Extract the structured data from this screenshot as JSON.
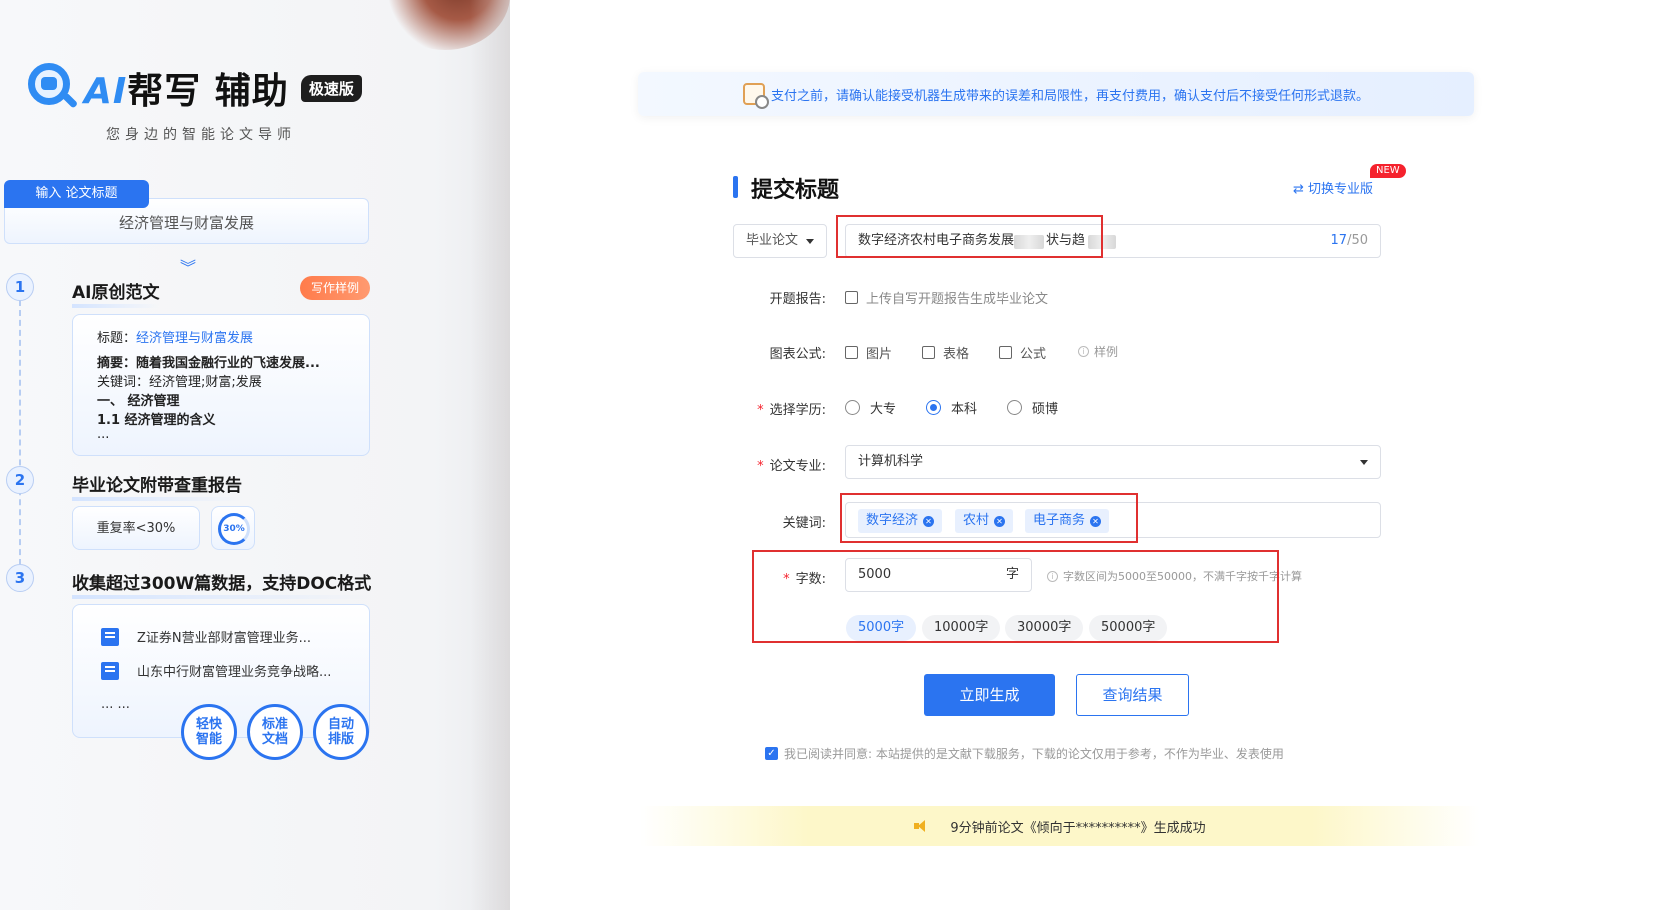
{
  "brand": {
    "logo_ai": "AI",
    "logo_name": "帮写 辅助",
    "logo_badge": "极速版",
    "slogan": "您身边的智能论文导师"
  },
  "sidebar": {
    "input_tab": "输入 论文标题",
    "input_value": "经济管理与财富发展",
    "steps": [
      {
        "num": "1",
        "title": "AI原创范文",
        "badge": "写作样例"
      },
      {
        "num": "2",
        "title": "毕业论文附带查重报告"
      },
      {
        "num": "3",
        "title": "收集超过300W篇数据，支持DOC格式"
      }
    ],
    "sample": {
      "title_label": "标题：",
      "title_value": "经济管理与财富发展",
      "abstract": "摘要：随着我国金融行业的飞速发展...",
      "keywords": "关键词：经济管理;财富;发展",
      "heading1": "一、 经济管理",
      "heading11": "1.1 经济管理的含义",
      "ellipsis": "..."
    },
    "report": {
      "rate": "重复率<30%",
      "ring": "30%",
      "ring_value": 30
    },
    "docs": [
      "Z证券N营业部财富管理业务...",
      "山东中行财富管理业务竞争战略..."
    ],
    "docs_more": "... ...",
    "badges": [
      "轻快\n智能",
      "标准\n文档",
      "自动\n排版"
    ]
  },
  "notice": "支付之前，请确认能接受机器生成带来的误差和局限性，再支付费用，确认支付后不接受任何形式退款。",
  "form": {
    "title": "提交标题",
    "switch_label": "切换专业版",
    "new_tag": "NEW",
    "paper_type": "毕业论文",
    "paper_title": "数字经济农村电子商务发展",
    "paper_title_tail": "状与趋",
    "title_count": "17",
    "title_max": "/50",
    "proposal_label": "开题报告:",
    "proposal_option": "上传自写开题报告生成毕业论文",
    "charts_label": "图表公式:",
    "charts_options": [
      "图片",
      "表格",
      "公式"
    ],
    "charts_example": "样例",
    "degree_label": "选择学历:",
    "degree_options": [
      "大专",
      "本科",
      "硕博"
    ],
    "degree_selected": "本科",
    "major_label": "论文专业:",
    "major_value": "计算机科学",
    "keywords_label": "关键词:",
    "keywords": [
      "数字经济",
      "农村",
      "电子商务"
    ],
    "wordcount_label": "字数:",
    "wordcount_value": "5000",
    "wordcount_unit": "字",
    "wordcount_tip": "字数区间为5000至50000，不满千字按千字计算",
    "wordcount_options": [
      "5000字",
      "10000字",
      "30000字",
      "50000字"
    ],
    "wordcount_selected": "5000字",
    "generate_button": "立即生成",
    "query_button": "查询结果",
    "agreement": "我已阅读并同意: 本站提供的是文献下载服务，下载的论文仅用于参考，不作为毕业、发表使用",
    "agreement_checked": true
  },
  "banner": "9分钟前论文《倾向于**********》生成成功",
  "colors": {
    "primary": "#2b74f0",
    "highlight_box": "#e03030",
    "sample_badge": "#ff7b4b"
  }
}
